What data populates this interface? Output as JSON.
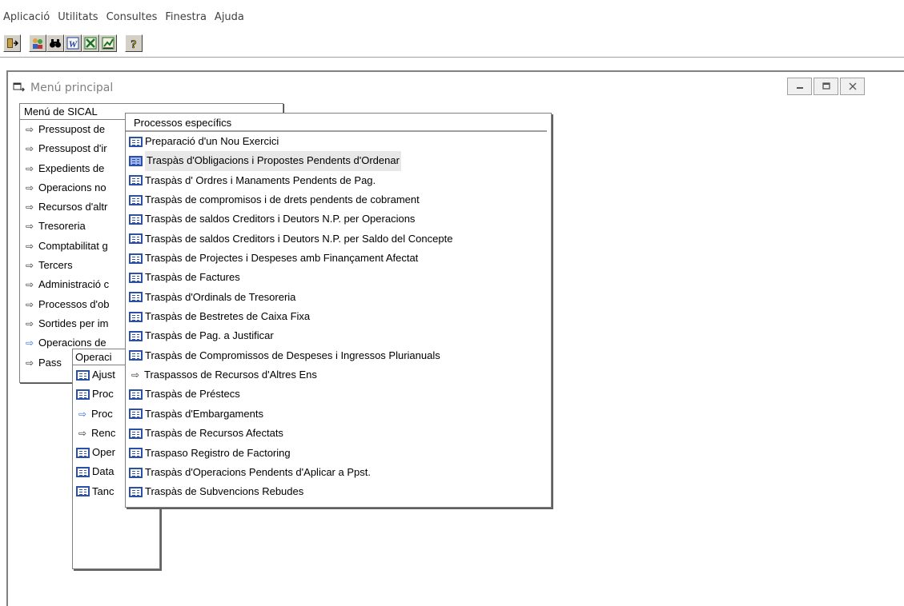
{
  "menubar": {
    "items": [
      "Aplicació",
      "Utilitats",
      "Consultes",
      "Finestra",
      "Ajuda"
    ]
  },
  "toolbar": {
    "buttons": [
      {
        "icon": "exit-door-icon",
        "glyph": "⇥"
      },
      {
        "icon": "users-icon",
        "glyph": "👥"
      },
      {
        "icon": "binoculars-icon",
        "glyph": "👓"
      },
      {
        "icon": "word-icon",
        "glyph": "W"
      },
      {
        "icon": "excel-icon",
        "glyph": "X"
      },
      {
        "icon": "chart-icon",
        "glyph": "↗"
      },
      {
        "icon": "help-icon",
        "glyph": "?"
      }
    ]
  },
  "window": {
    "title": "Menú principal"
  },
  "menu_sical": {
    "header": "Menú de SICAL",
    "items": [
      "Pressupost de",
      "Pressupost d'ir",
      "Expedients de",
      "Operacions no",
      "Recursos d'altr",
      "Tresoreria",
      "Comptabilitat g",
      "Tercers",
      "Administració c",
      "Processos d'ob",
      "Sortides per im",
      "Operacions de",
      "Pass"
    ]
  },
  "menu_operacions": {
    "header": "Operaci",
    "items": [
      {
        "icon": "form",
        "label": "Ajust"
      },
      {
        "icon": "form",
        "label": "Proc"
      },
      {
        "icon": "arrow-active",
        "label": "Proc"
      },
      {
        "icon": "arrow",
        "label": "Renc"
      },
      {
        "icon": "form",
        "label": "Oper"
      },
      {
        "icon": "form",
        "label": "Data"
      },
      {
        "icon": "form",
        "label": "Tanc"
      }
    ]
  },
  "menu_processos": {
    "header": "Processos específics",
    "items": [
      {
        "icon": "form",
        "label": "Preparació d'un Nou Exercici"
      },
      {
        "icon": "form-selected",
        "label": "Traspàs d'Obligacions i Propostes Pendents d'Ordenar"
      },
      {
        "icon": "form",
        "label": "Traspàs d' Ordres i Manaments Pendents de Pag."
      },
      {
        "icon": "form",
        "label": "Traspàs de compromisos i de drets pendents de cobrament"
      },
      {
        "icon": "form",
        "label": "Traspàs de saldos Creditors i Deutors N.P. per Operacions"
      },
      {
        "icon": "form",
        "label": "Traspàs de saldos Creditors i Deutors N.P. per Saldo del Concepte"
      },
      {
        "icon": "form",
        "label": "Traspàs de Projectes i Despeses amb Finançament Afectat"
      },
      {
        "icon": "form",
        "label": "Traspàs de Factures"
      },
      {
        "icon": "form",
        "label": "Traspàs d'Ordinals de Tresoreria"
      },
      {
        "icon": "form",
        "label": "Traspàs de Bestretes de Caixa Fixa"
      },
      {
        "icon": "form",
        "label": "Traspàs de Pag. a Justificar"
      },
      {
        "icon": "form",
        "label": "Traspàs de Compromissos de Despeses i Ingressos Plurianuals"
      },
      {
        "icon": "arrow",
        "label": "Traspassos de Recursos d'Altres Ens"
      },
      {
        "icon": "form",
        "label": "Traspàs de Préstecs"
      },
      {
        "icon": "form",
        "label": "Traspàs d'Embargaments"
      },
      {
        "icon": "form",
        "label": "Traspàs de Recursos Afectats"
      },
      {
        "icon": "form",
        "label": "Traspaso Registro de Factoring"
      },
      {
        "icon": "form",
        "label": "Traspàs d'Operacions Pendents d'Aplicar a Ppst."
      },
      {
        "icon": "form",
        "label": "Traspàs de Subvencions Rebudes"
      }
    ]
  }
}
